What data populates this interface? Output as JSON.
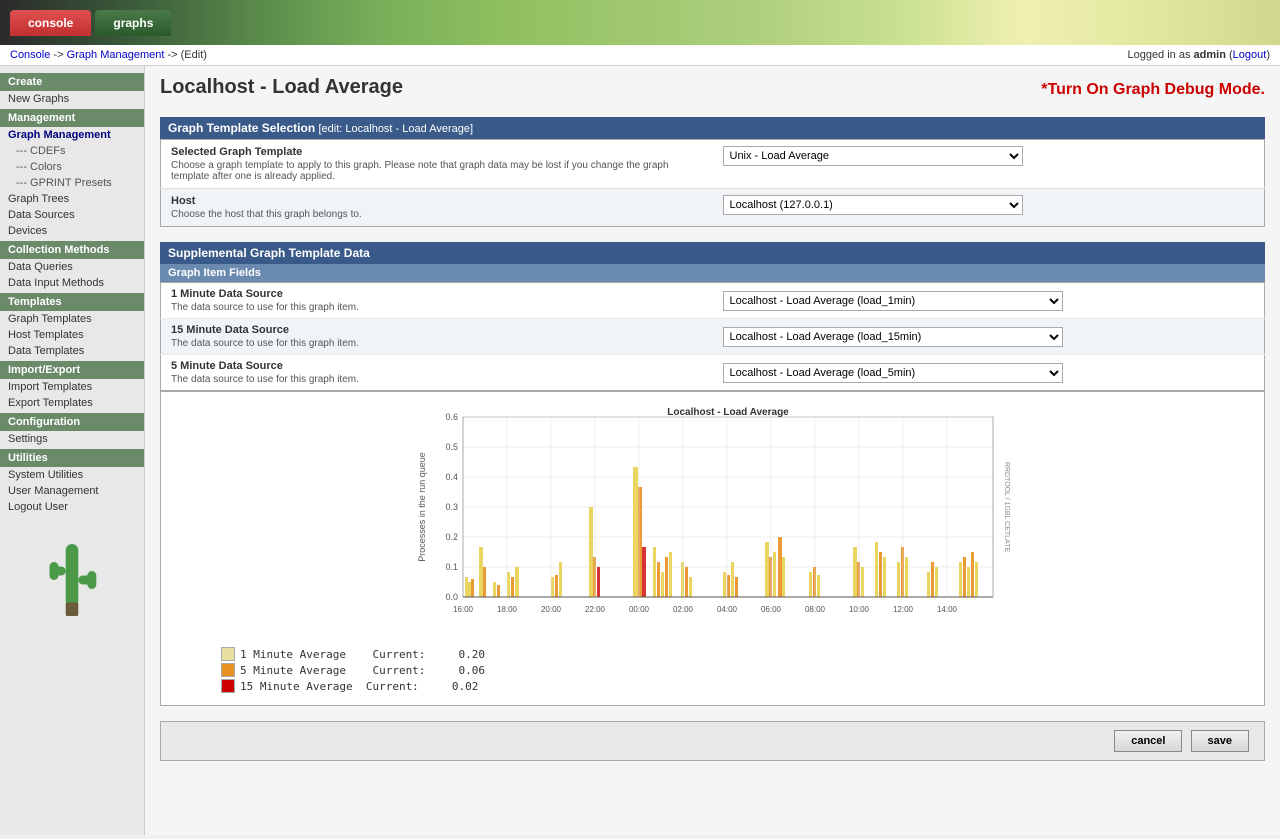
{
  "header": {
    "console_tab": "console",
    "graphs_tab": "graphs"
  },
  "breadcrumb": {
    "console": "Console",
    "arrow1": "->",
    "graph_management": "Graph Management",
    "arrow2": "->",
    "edit": "(Edit)",
    "logged_in_prefix": "Logged in as ",
    "user": "admin",
    "logout_label": "Logout"
  },
  "sidebar": {
    "create_section": "Create",
    "new_graphs": "New Graphs",
    "management_section": "Management",
    "graph_management": "Graph Management",
    "cdefs": "--- CDEFs",
    "colors": "--- Colors",
    "gprint_presets": "--- GPRINT Presets",
    "graph_trees": "Graph Trees",
    "data_sources": "Data Sources",
    "devices": "Devices",
    "collection_methods": "Collection Methods",
    "data_queries": "Data Queries",
    "data_input_methods": "Data Input Methods",
    "templates_section": "Templates",
    "graph_templates": "Graph Templates",
    "host_templates": "Host Templates",
    "data_templates": "Data Templates",
    "import_export_section": "Import/Export",
    "import_templates": "Import Templates",
    "export_templates": "Export Templates",
    "configuration_section": "Configuration",
    "settings": "Settings",
    "utilities_section": "Utilities",
    "system_utilities": "System Utilities",
    "user_management": "User Management",
    "logout_user": "Logout User"
  },
  "page": {
    "title": "Localhost - Load Average",
    "debug_mode_label": "*Turn On Graph Debug Mode."
  },
  "graph_template_selection": {
    "section_title": "Graph Template Selection",
    "section_edit": "[edit: Localhost - Load Average]",
    "selected_graph_template_label": "Selected Graph Template",
    "selected_graph_template_desc": "Choose a graph template to apply to this graph. Please note that graph data may be lost if you change the graph template after one is already applied.",
    "selected_graph_template_value": "Unix - Load Average",
    "host_label": "Host",
    "host_desc": "Choose the host that this graph belongs to.",
    "host_value": "Localhost (127.0.0.1)"
  },
  "supplemental": {
    "section_title": "Supplemental Graph Template Data",
    "graph_item_fields": "Graph Item Fields",
    "datasource_1_label": "1 Minute Data Source",
    "datasource_1_desc": "The data source to use for this graph item.",
    "datasource_1_value": "Localhost - Load Average (load_1min)",
    "datasource_15_label": "15 Minute Data Source",
    "datasource_15_desc": "The data source to use for this graph item.",
    "datasource_15_value": "Localhost - Load Average (load_15min)",
    "datasource_5_label": "5 Minute Data Source",
    "datasource_5_desc": "The data source to use for this graph item.",
    "datasource_5_value": "Localhost - Load Average (load_5min)"
  },
  "chart": {
    "title": "Localhost - Load Average",
    "y_label": "Processes in the run queue",
    "x_labels": [
      "16:00",
      "18:00",
      "20:00",
      "22:00",
      "00:00",
      "02:00",
      "04:00",
      "06:00",
      "08:00",
      "10:00",
      "12:00",
      "14:00"
    ],
    "y_values": [
      "0.6",
      "0.5",
      "0.4",
      "0.3",
      "0.2",
      "0.1",
      "0.0"
    ]
  },
  "legend": {
    "items": [
      {
        "color": "#e8d050",
        "label": "1 Minute Average",
        "metric": "Current:",
        "value": "0.20"
      },
      {
        "color": "#e89020",
        "label": "5 Minute Average",
        "metric": "Current:",
        "value": "0.06"
      },
      {
        "color": "#cc0000",
        "label": "15 Minute Average",
        "metric": "Current:",
        "value": "0.02"
      }
    ]
  },
  "buttons": {
    "cancel": "cancel",
    "save": "save"
  }
}
